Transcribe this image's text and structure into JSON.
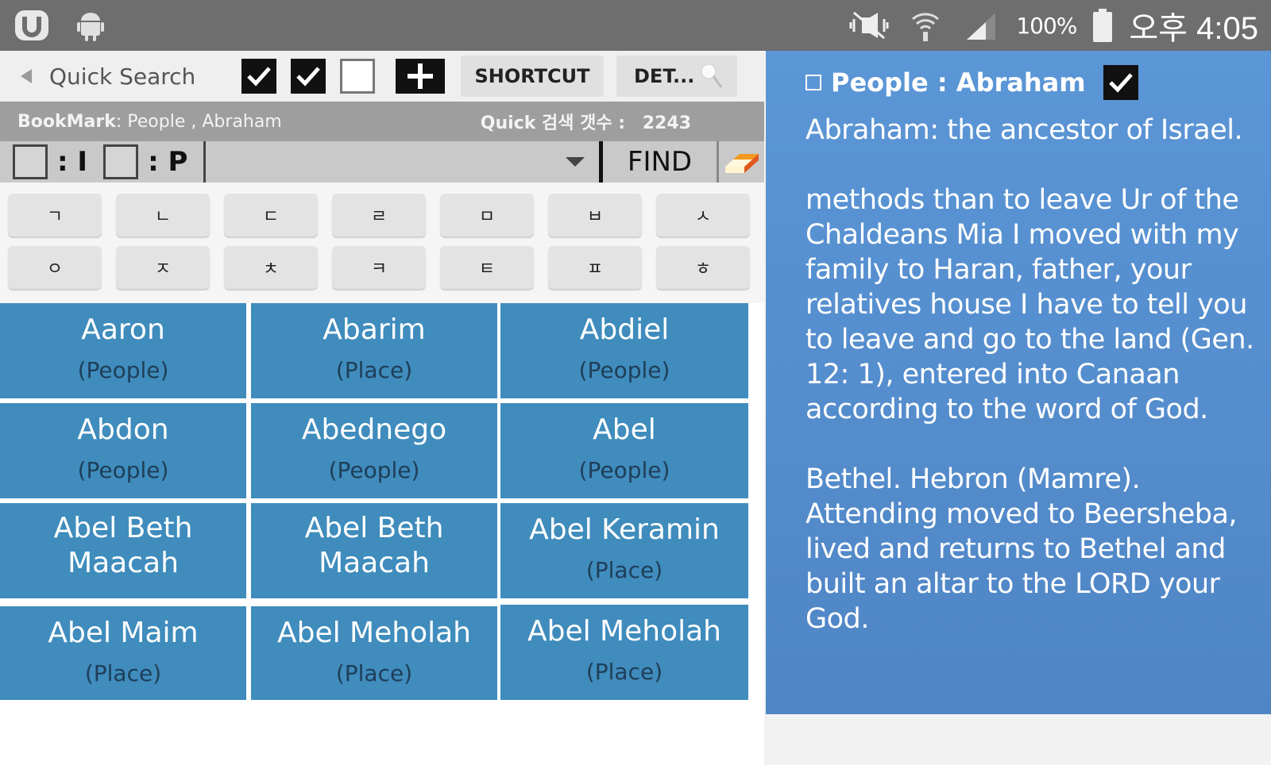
{
  "status_bar": {
    "battery_text": "100%",
    "time": "오후 4:05",
    "icons": [
      "u-app-icon",
      "android-icon",
      "mute-icon",
      "wifi-icon",
      "signal-icon",
      "battery-icon"
    ]
  },
  "toolbar": {
    "quick_search_label": "Quick Search",
    "shortcut_label": "SHORTCUT",
    "det_label": "DET...",
    "checkboxes": [
      true,
      true,
      false
    ]
  },
  "bookmark_bar": {
    "bookmark_label": "BookMark",
    "bookmark_value": " : People , Abraham",
    "count_label": "Quick 검색 갯수 :",
    "count_value": "2243"
  },
  "filter_row": {
    "i_label": ": I",
    "p_label": ": P",
    "find_label": "FIND"
  },
  "keypad": {
    "keys": [
      "ㄱ",
      "ㄴ",
      "ㄷ",
      "ㄹ",
      "ㅁ",
      "ㅂ",
      "ㅅ",
      "ㅇ",
      "ㅈ",
      "ㅊ",
      "ㅋ",
      "ㅌ",
      "ㅍ",
      "ㅎ"
    ]
  },
  "results": [
    {
      "name": "Aaron",
      "type": "(People)"
    },
    {
      "name": "Abarim",
      "type": "(Place)"
    },
    {
      "name": "Abdiel",
      "type": "(People)"
    },
    {
      "name": "Abdon",
      "type": "(People)"
    },
    {
      "name": "Abednego",
      "type": "(People)"
    },
    {
      "name": "Abel",
      "type": "(People)"
    },
    {
      "name": "Abel Beth Maacah",
      "type": ""
    },
    {
      "name": "Abel Beth Maacah",
      "type": ""
    },
    {
      "name": "Abel Keramin",
      "type": "(Place)"
    },
    {
      "name": "Abel Maim",
      "type": "(Place)"
    },
    {
      "name": "Abel Meholah",
      "type": "(Place)"
    },
    {
      "name": "Abel Meholah",
      "type": "(Place)"
    }
  ],
  "detail": {
    "title": "People : Abraham",
    "paragraphs": [
      "Abraham: the ancestor of Israel.",
      " methods than to leave Ur of the Chaldeans Mia I moved with my family to Haran, father, your relatives house I have to tell you to leave and go to the land (Gen. 12: 1), entered into Canaan according to the word of God.",
      " Bethel. Hebron (Mamre). Attending moved to Beersheba, lived and returns to Bethel and built an altar to the LORD your God."
    ]
  },
  "colors": {
    "status_bar": "#6e6e6e",
    "result_cell": "#3f8cbd",
    "detail_bg": "#5b96d6",
    "type_text": "#1f3e58"
  }
}
